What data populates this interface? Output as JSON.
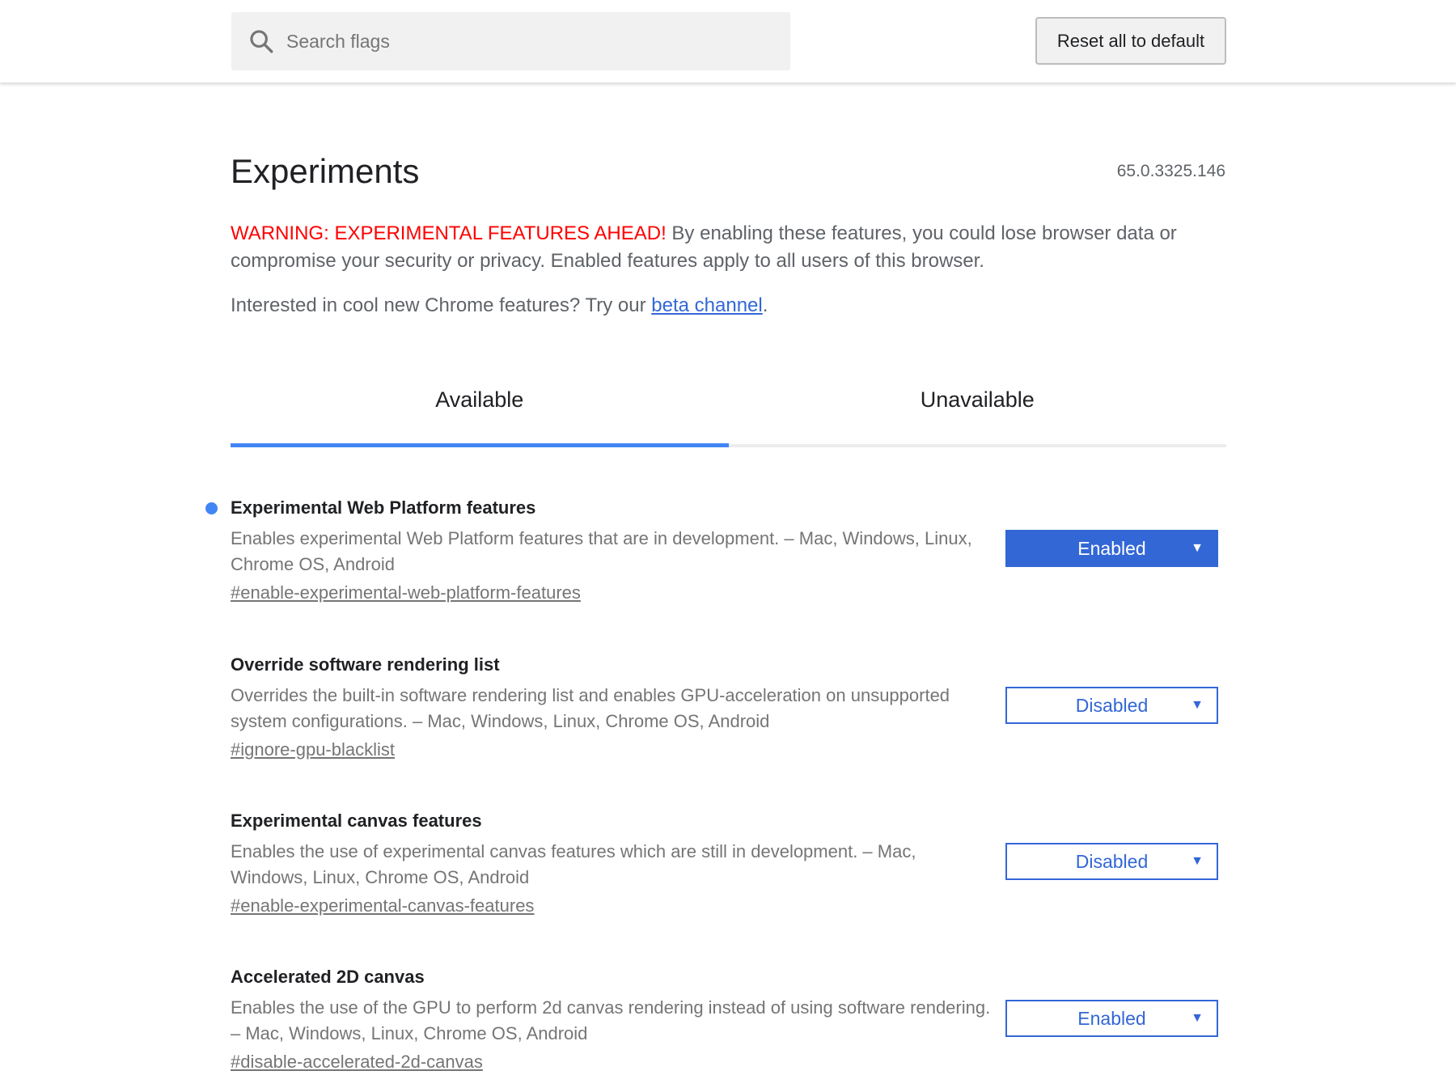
{
  "search": {
    "placeholder": "Search flags"
  },
  "header": {
    "reset_label": "Reset all to default"
  },
  "page": {
    "title": "Experiments",
    "version": "65.0.3325.146",
    "warning_red": "WARNING: EXPERIMENTAL FEATURES AHEAD!",
    "warning_rest": " By enabling these features, you could lose browser data or compromise your security or privacy. Enabled features apply to all users of this browser.",
    "beta_prefix": "Interested in cool new Chrome features? Try our ",
    "beta_link": "beta channel",
    "beta_suffix": "."
  },
  "tabs": [
    {
      "label": "Available",
      "active": true
    },
    {
      "label": "Unavailable",
      "active": false
    }
  ],
  "experiments": [
    {
      "title": "Experimental Web Platform features",
      "description": "Enables experimental Web Platform features that are in development. – Mac, Windows, Linux, Chrome OS, Android",
      "link": "#enable-experimental-web-platform-features",
      "value": "Enabled",
      "modified": true
    },
    {
      "title": "Override software rendering list",
      "description": "Overrides the built-in software rendering list and enables GPU-acceleration on unsupported system configurations. – Mac, Windows, Linux, Chrome OS, Android",
      "link": "#ignore-gpu-blacklist",
      "value": "Disabled",
      "modified": false
    },
    {
      "title": "Experimental canvas features",
      "description": "Enables the use of experimental canvas features which are still in development. – Mac, Windows, Linux, Chrome OS, Android",
      "link": "#enable-experimental-canvas-features",
      "value": "Disabled",
      "modified": false
    },
    {
      "title": "Accelerated 2D canvas",
      "description": "Enables the use of the GPU to perform 2d canvas rendering instead of using software rendering. – Mac, Windows, Linux, Chrome OS, Android",
      "link": "#disable-accelerated-2d-canvas",
      "value": "Enabled",
      "modified": false
    }
  ],
  "dropdown_arrow": "▼",
  "colors": {
    "accent": "#3367d6",
    "tab_indicator": "#4285f4",
    "warning": "#ff0000"
  }
}
